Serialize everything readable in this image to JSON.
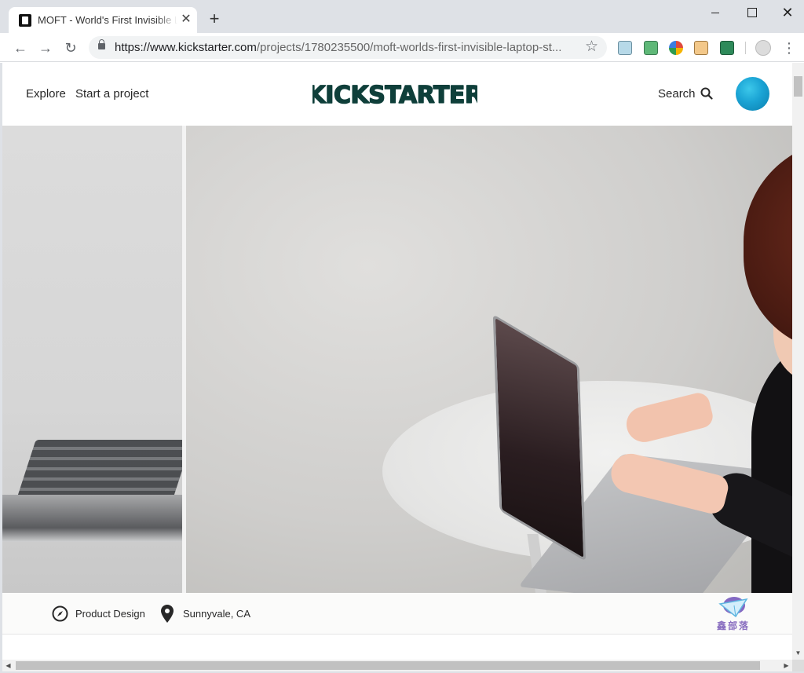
{
  "browser": {
    "tab_title": "MOFT - World's First Invisible Laptop Stand",
    "tab_close": "✕",
    "new_tab": "+",
    "url_host": "https://www.kickstarter.com",
    "url_path": "/projects/1780235500/moft-worlds-first-invisible-laptop-st...",
    "back_icon": "←",
    "forward_icon": "→",
    "reload_icon": "↻",
    "star_icon": "☆",
    "menu_icon": "⋮",
    "window": {
      "close": "✕"
    },
    "extensions": [
      "ext-icon-1",
      "ext-icon-2",
      "ext-icon-3",
      "ext-icon-4",
      "ext-icon-5",
      "profile-icon"
    ]
  },
  "header": {
    "explore": "Explore",
    "start_project": "Start a project",
    "logo_text": "KICKSTARTER",
    "logo_color": "#05ce78",
    "logo_fill": "#0f3f3a",
    "search": "Search"
  },
  "hero": {
    "alt": ""
  },
  "info": {
    "category": "Product Design",
    "location": "Sunnyvale, CA"
  },
  "watermark": {
    "text": "鑫部落"
  },
  "scrollbars": {
    "up": "▲",
    "down": "▼",
    "left": "◀",
    "right": "▶"
  }
}
